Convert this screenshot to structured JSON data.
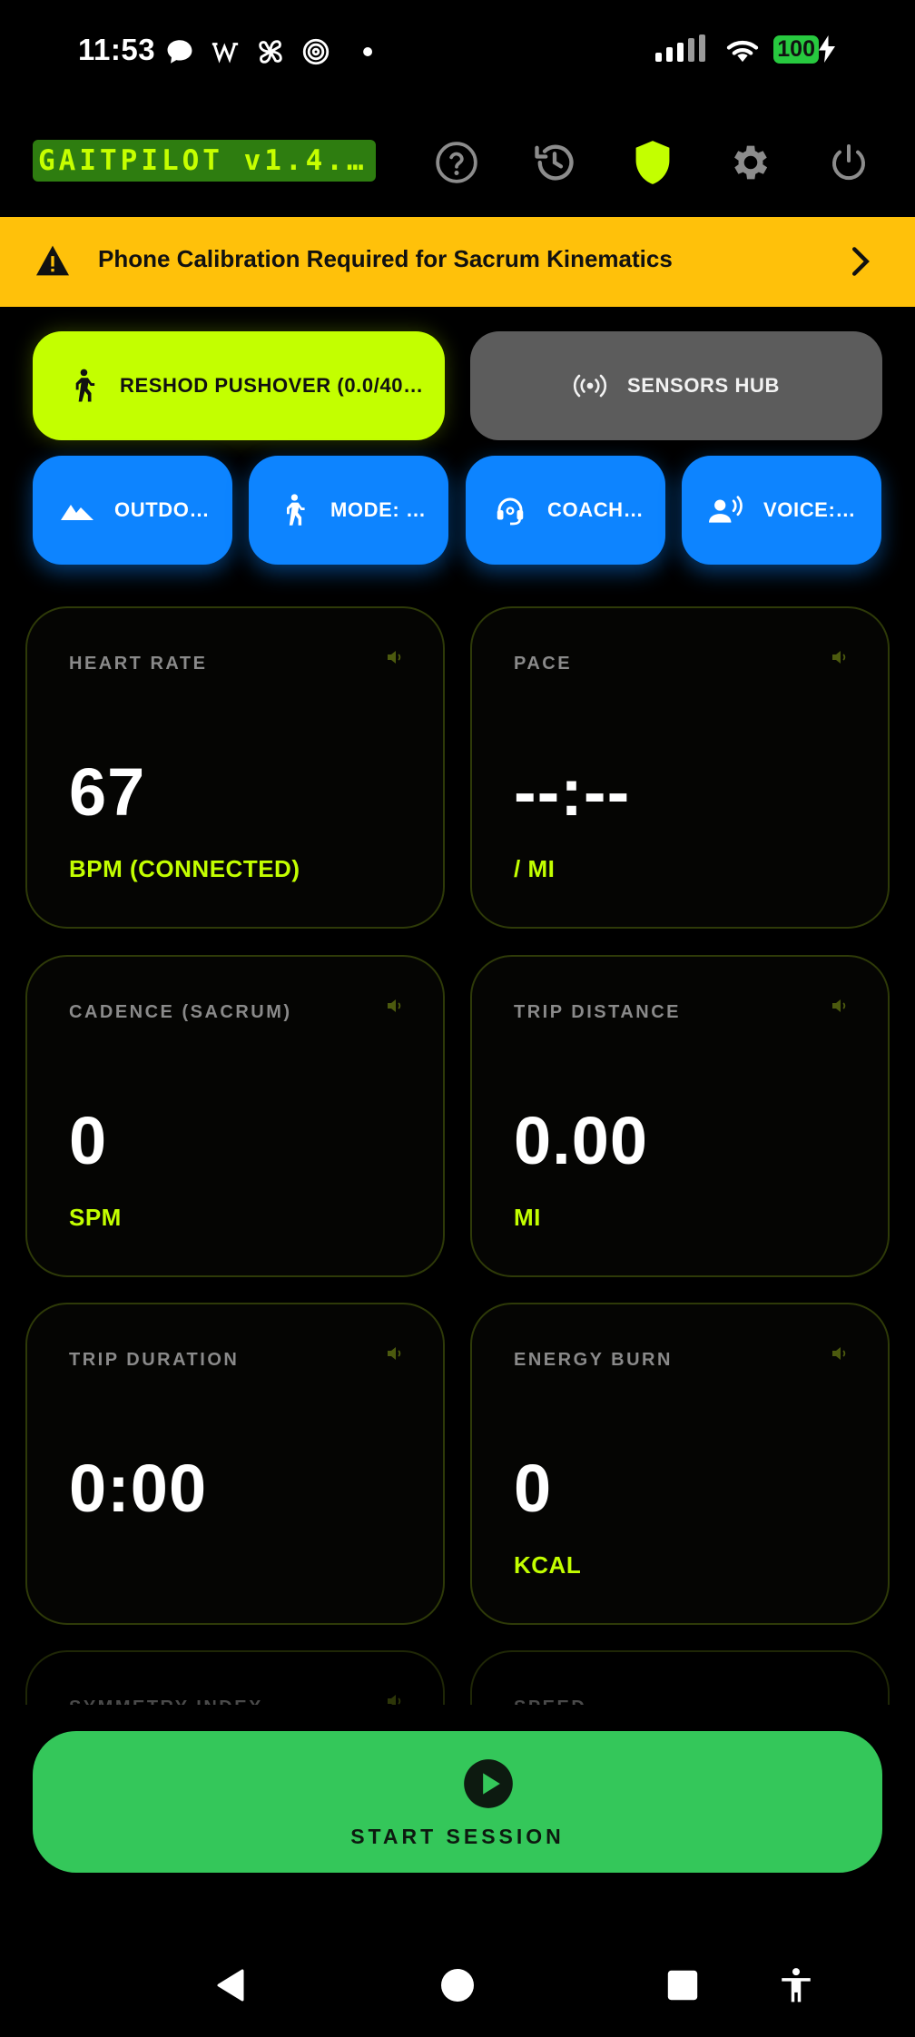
{
  "status_bar": {
    "time": "11:53",
    "notification_icons": [
      "chat-bubble-icon",
      "wikipedia-icon",
      "pinwheel-icon",
      "spiral-icon",
      "dot-icon"
    ],
    "battery_level": "100",
    "battery_charging": true
  },
  "top_bar": {
    "app_title": "GAITPILOT v1.4.…",
    "buttons": [
      "help-icon",
      "history-icon",
      "shield-icon",
      "gear-icon",
      "power-icon"
    ],
    "active_color": "#c3ff00"
  },
  "banner": {
    "text": "Phone Calibration Required for Sacrum Kinematics",
    "color": "#ffc10a"
  },
  "actions": {
    "reshod_label": "RESHOD PUSHOVER (0.0/40…",
    "sensors_label": "SENSORS HUB",
    "outdoor_label": "OUTDO…",
    "mode_label": "MODE: …",
    "coach_label": "COACH…",
    "voice_label": "VOICE:…"
  },
  "metrics": {
    "heart_rate": {
      "label": "HEART RATE",
      "value": "67",
      "unit": "BPM (CONNECTED)"
    },
    "pace": {
      "label": "PACE",
      "value": "--:--",
      "unit": "/ MI"
    },
    "cadence": {
      "label": "CADENCE (SACRUM)",
      "value": "0",
      "unit": "SPM"
    },
    "trip_distance": {
      "label": "TRIP DISTANCE",
      "value": "0.00",
      "unit": "MI"
    },
    "trip_duration": {
      "label": "TRIP DURATION",
      "value": "0:00",
      "unit": ""
    },
    "energy_burn": {
      "label": "ENERGY BURN",
      "value": "0",
      "unit": "KCAL"
    },
    "symmetry_index": {
      "label": "SYMMETRY INDEX"
    },
    "speed": {
      "label": "SPEED"
    }
  },
  "start_session": {
    "label": "START SESSION",
    "color": "#34c75a"
  },
  "nav": [
    "back-icon",
    "home-icon",
    "recents-icon",
    "accessibility-icon"
  ]
}
